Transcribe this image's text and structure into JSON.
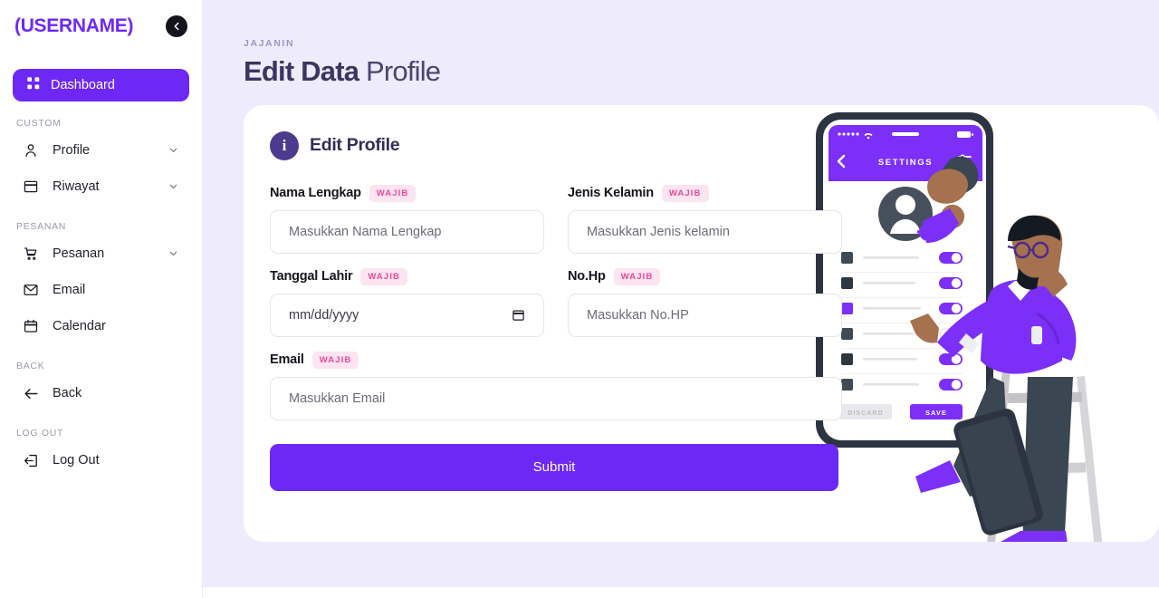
{
  "sidebar": {
    "brand": "(USERNAME)",
    "back_icon": "arrow-left-circle-icon",
    "dashboard": {
      "label": "Dashboard",
      "icon": "grid-hash-icon"
    },
    "sections": [
      {
        "label": "CUSTOM",
        "items": [
          {
            "label": "Profile",
            "icon": "user-icon",
            "chevron": "chevron-down-icon"
          },
          {
            "label": "Riwayat",
            "icon": "window-icon",
            "chevron": "chevron-down-icon"
          }
        ]
      },
      {
        "label": "PESANAN",
        "items": [
          {
            "label": "Pesanan",
            "icon": "cart-icon",
            "chevron": "chevron-down-icon"
          },
          {
            "label": "Email",
            "icon": "envelope-icon",
            "chevron": ""
          },
          {
            "label": "Calendar",
            "icon": "calendar-icon",
            "chevron": ""
          }
        ]
      },
      {
        "label": "BACK",
        "items": [
          {
            "label": "Back",
            "icon": "arrow-left-icon",
            "chevron": ""
          }
        ]
      },
      {
        "label": "LOG OUT",
        "items": [
          {
            "label": "Log Out",
            "icon": "logout-icon",
            "chevron": ""
          }
        ]
      }
    ]
  },
  "header": {
    "breadcrumb": "JAJANIN",
    "title_bold": "Edit Data",
    "title_light": "Profile"
  },
  "card": {
    "icon": "info-icon",
    "icon_glyph": "i",
    "title": "Edit Profile",
    "required_badge": "WAJIB",
    "fields": {
      "nama": {
        "label": "Nama Lengkap",
        "placeholder": "Masukkan Nama Lengkap",
        "value": ""
      },
      "jenis_kelamin": {
        "label": "Jenis Kelamin",
        "placeholder": "Masukkan Jenis kelamin",
        "value": ""
      },
      "tanggal_lahir": {
        "label": "Tanggal Lahir",
        "placeholder": "mm/dd/yyyy",
        "value": "mm/dd/yyyy"
      },
      "no_hp": {
        "label": "No.Hp",
        "placeholder": "Masukkan No.HP",
        "value": ""
      },
      "email": {
        "label": "Email",
        "placeholder": "Masukkan Email",
        "value": ""
      }
    },
    "submit_label": "Submit"
  },
  "illustration": {
    "name": "person-on-ladder-with-phone-settings",
    "phone": {
      "status_wifi": "wifi-icon",
      "status_battery": "battery-icon",
      "back_icon": "chevron-left-icon",
      "screen_title": "SETTINGS",
      "filter_icon": "sliders-icon",
      "avatar_icon": "user-avatar-icon",
      "gear_icon": "gear-icon",
      "discard_label": "DISCARD",
      "save_label": "SAVE"
    }
  },
  "colors": {
    "accent": "#6d28f5",
    "page_bg": "#eeebfd",
    "badge_bg": "#fce4f0",
    "badge_text": "#ec4899",
    "title": "#3b3560",
    "info_circle": "#4c3a8e"
  }
}
